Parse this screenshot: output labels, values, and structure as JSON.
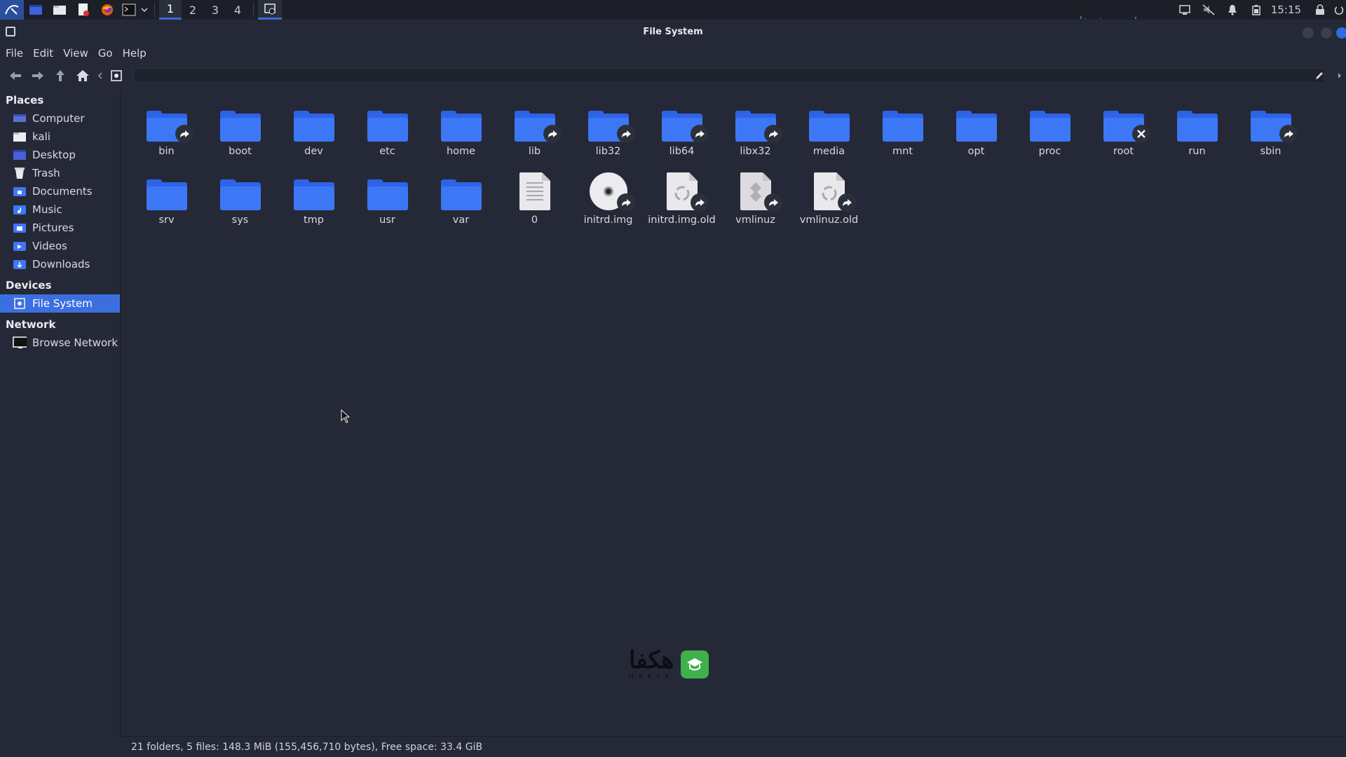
{
  "panel": {
    "workspaces": [
      "1",
      "2",
      "3",
      "4"
    ],
    "active_workspace": "1",
    "clock": "15:15"
  },
  "window": {
    "title": "File System"
  },
  "menubar": {
    "file": "File",
    "edit": "Edit",
    "view": "View",
    "go": "Go",
    "help": "Help"
  },
  "sidebar": {
    "places_header": "Places",
    "places": [
      {
        "label": "Computer",
        "icon": "computer-icon"
      },
      {
        "label": "kali",
        "icon": "home-folder-icon"
      },
      {
        "label": "Desktop",
        "icon": "desktop-icon"
      },
      {
        "label": "Trash",
        "icon": "trash-icon"
      },
      {
        "label": "Documents",
        "icon": "documents-folder-icon"
      },
      {
        "label": "Music",
        "icon": "music-folder-icon"
      },
      {
        "label": "Pictures",
        "icon": "pictures-folder-icon"
      },
      {
        "label": "Videos",
        "icon": "videos-folder-icon"
      },
      {
        "label": "Downloads",
        "icon": "downloads-folder-icon"
      }
    ],
    "devices_header": "Devices",
    "devices": [
      {
        "label": "File System",
        "icon": "drive-icon",
        "selected": true
      }
    ],
    "network_header": "Network",
    "network": [
      {
        "label": "Browse Network",
        "icon": "network-icon"
      }
    ]
  },
  "files": [
    {
      "name": "bin",
      "type": "folder",
      "emblem": "symlink"
    },
    {
      "name": "boot",
      "type": "folder"
    },
    {
      "name": "dev",
      "type": "folder"
    },
    {
      "name": "etc",
      "type": "folder"
    },
    {
      "name": "home",
      "type": "folder"
    },
    {
      "name": "lib",
      "type": "folder",
      "emblem": "symlink"
    },
    {
      "name": "lib32",
      "type": "folder",
      "emblem": "symlink"
    },
    {
      "name": "lib64",
      "type": "folder",
      "emblem": "symlink"
    },
    {
      "name": "libx32",
      "type": "folder",
      "emblem": "symlink"
    },
    {
      "name": "media",
      "type": "folder"
    },
    {
      "name": "mnt",
      "type": "folder"
    },
    {
      "name": "opt",
      "type": "folder"
    },
    {
      "name": "proc",
      "type": "folder"
    },
    {
      "name": "root",
      "type": "folder",
      "emblem": "unreadable"
    },
    {
      "name": "run",
      "type": "folder"
    },
    {
      "name": "sbin",
      "type": "folder",
      "emblem": "symlink"
    },
    {
      "name": "srv",
      "type": "folder"
    },
    {
      "name": "sys",
      "type": "folder"
    },
    {
      "name": "tmp",
      "type": "folder"
    },
    {
      "name": "usr",
      "type": "folder"
    },
    {
      "name": "var",
      "type": "folder"
    },
    {
      "name": "0",
      "type": "text"
    },
    {
      "name": "initrd.img",
      "type": "disc",
      "emblem": "symlink"
    },
    {
      "name": "initrd.img.old",
      "type": "archive",
      "emblem": "symlink"
    },
    {
      "name": "vmlinuz",
      "type": "binary",
      "emblem": "symlink"
    },
    {
      "name": "vmlinuz.old",
      "type": "archive",
      "emblem": "symlink"
    }
  ],
  "watermark": {
    "text": "هکفا",
    "sub": "HAKFA"
  },
  "status": {
    "text": "21 folders, 5 files: 148.3 MiB (155,456,710 bytes), Free space: 33.4 GiB"
  },
  "colors": {
    "accent": "#3b6fe0",
    "folder": "#3c78f5",
    "background": "#252937"
  }
}
